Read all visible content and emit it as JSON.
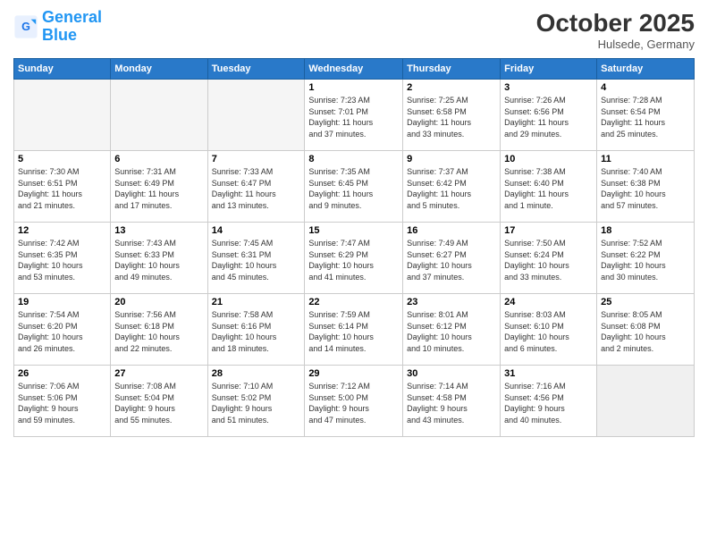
{
  "logo": {
    "line1": "General",
    "line2": "Blue"
  },
  "title": "October 2025",
  "location": "Hulsede, Germany",
  "days_header": [
    "Sunday",
    "Monday",
    "Tuesday",
    "Wednesday",
    "Thursday",
    "Friday",
    "Saturday"
  ],
  "weeks": [
    [
      {
        "num": "",
        "info": ""
      },
      {
        "num": "",
        "info": ""
      },
      {
        "num": "",
        "info": ""
      },
      {
        "num": "1",
        "info": "Sunrise: 7:23 AM\nSunset: 7:01 PM\nDaylight: 11 hours\nand 37 minutes."
      },
      {
        "num": "2",
        "info": "Sunrise: 7:25 AM\nSunset: 6:58 PM\nDaylight: 11 hours\nand 33 minutes."
      },
      {
        "num": "3",
        "info": "Sunrise: 7:26 AM\nSunset: 6:56 PM\nDaylight: 11 hours\nand 29 minutes."
      },
      {
        "num": "4",
        "info": "Sunrise: 7:28 AM\nSunset: 6:54 PM\nDaylight: 11 hours\nand 25 minutes."
      }
    ],
    [
      {
        "num": "5",
        "info": "Sunrise: 7:30 AM\nSunset: 6:51 PM\nDaylight: 11 hours\nand 21 minutes."
      },
      {
        "num": "6",
        "info": "Sunrise: 7:31 AM\nSunset: 6:49 PM\nDaylight: 11 hours\nand 17 minutes."
      },
      {
        "num": "7",
        "info": "Sunrise: 7:33 AM\nSunset: 6:47 PM\nDaylight: 11 hours\nand 13 minutes."
      },
      {
        "num": "8",
        "info": "Sunrise: 7:35 AM\nSunset: 6:45 PM\nDaylight: 11 hours\nand 9 minutes."
      },
      {
        "num": "9",
        "info": "Sunrise: 7:37 AM\nSunset: 6:42 PM\nDaylight: 11 hours\nand 5 minutes."
      },
      {
        "num": "10",
        "info": "Sunrise: 7:38 AM\nSunset: 6:40 PM\nDaylight: 11 hours\nand 1 minute."
      },
      {
        "num": "11",
        "info": "Sunrise: 7:40 AM\nSunset: 6:38 PM\nDaylight: 10 hours\nand 57 minutes."
      }
    ],
    [
      {
        "num": "12",
        "info": "Sunrise: 7:42 AM\nSunset: 6:35 PM\nDaylight: 10 hours\nand 53 minutes."
      },
      {
        "num": "13",
        "info": "Sunrise: 7:43 AM\nSunset: 6:33 PM\nDaylight: 10 hours\nand 49 minutes."
      },
      {
        "num": "14",
        "info": "Sunrise: 7:45 AM\nSunset: 6:31 PM\nDaylight: 10 hours\nand 45 minutes."
      },
      {
        "num": "15",
        "info": "Sunrise: 7:47 AM\nSunset: 6:29 PM\nDaylight: 10 hours\nand 41 minutes."
      },
      {
        "num": "16",
        "info": "Sunrise: 7:49 AM\nSunset: 6:27 PM\nDaylight: 10 hours\nand 37 minutes."
      },
      {
        "num": "17",
        "info": "Sunrise: 7:50 AM\nSunset: 6:24 PM\nDaylight: 10 hours\nand 33 minutes."
      },
      {
        "num": "18",
        "info": "Sunrise: 7:52 AM\nSunset: 6:22 PM\nDaylight: 10 hours\nand 30 minutes."
      }
    ],
    [
      {
        "num": "19",
        "info": "Sunrise: 7:54 AM\nSunset: 6:20 PM\nDaylight: 10 hours\nand 26 minutes."
      },
      {
        "num": "20",
        "info": "Sunrise: 7:56 AM\nSunset: 6:18 PM\nDaylight: 10 hours\nand 22 minutes."
      },
      {
        "num": "21",
        "info": "Sunrise: 7:58 AM\nSunset: 6:16 PM\nDaylight: 10 hours\nand 18 minutes."
      },
      {
        "num": "22",
        "info": "Sunrise: 7:59 AM\nSunset: 6:14 PM\nDaylight: 10 hours\nand 14 minutes."
      },
      {
        "num": "23",
        "info": "Sunrise: 8:01 AM\nSunset: 6:12 PM\nDaylight: 10 hours\nand 10 minutes."
      },
      {
        "num": "24",
        "info": "Sunrise: 8:03 AM\nSunset: 6:10 PM\nDaylight: 10 hours\nand 6 minutes."
      },
      {
        "num": "25",
        "info": "Sunrise: 8:05 AM\nSunset: 6:08 PM\nDaylight: 10 hours\nand 2 minutes."
      }
    ],
    [
      {
        "num": "26",
        "info": "Sunrise: 7:06 AM\nSunset: 5:06 PM\nDaylight: 9 hours\nand 59 minutes."
      },
      {
        "num": "27",
        "info": "Sunrise: 7:08 AM\nSunset: 5:04 PM\nDaylight: 9 hours\nand 55 minutes."
      },
      {
        "num": "28",
        "info": "Sunrise: 7:10 AM\nSunset: 5:02 PM\nDaylight: 9 hours\nand 51 minutes."
      },
      {
        "num": "29",
        "info": "Sunrise: 7:12 AM\nSunset: 5:00 PM\nDaylight: 9 hours\nand 47 minutes."
      },
      {
        "num": "30",
        "info": "Sunrise: 7:14 AM\nSunset: 4:58 PM\nDaylight: 9 hours\nand 43 minutes."
      },
      {
        "num": "31",
        "info": "Sunrise: 7:16 AM\nSunset: 4:56 PM\nDaylight: 9 hours\nand 40 minutes."
      },
      {
        "num": "",
        "info": ""
      }
    ]
  ]
}
